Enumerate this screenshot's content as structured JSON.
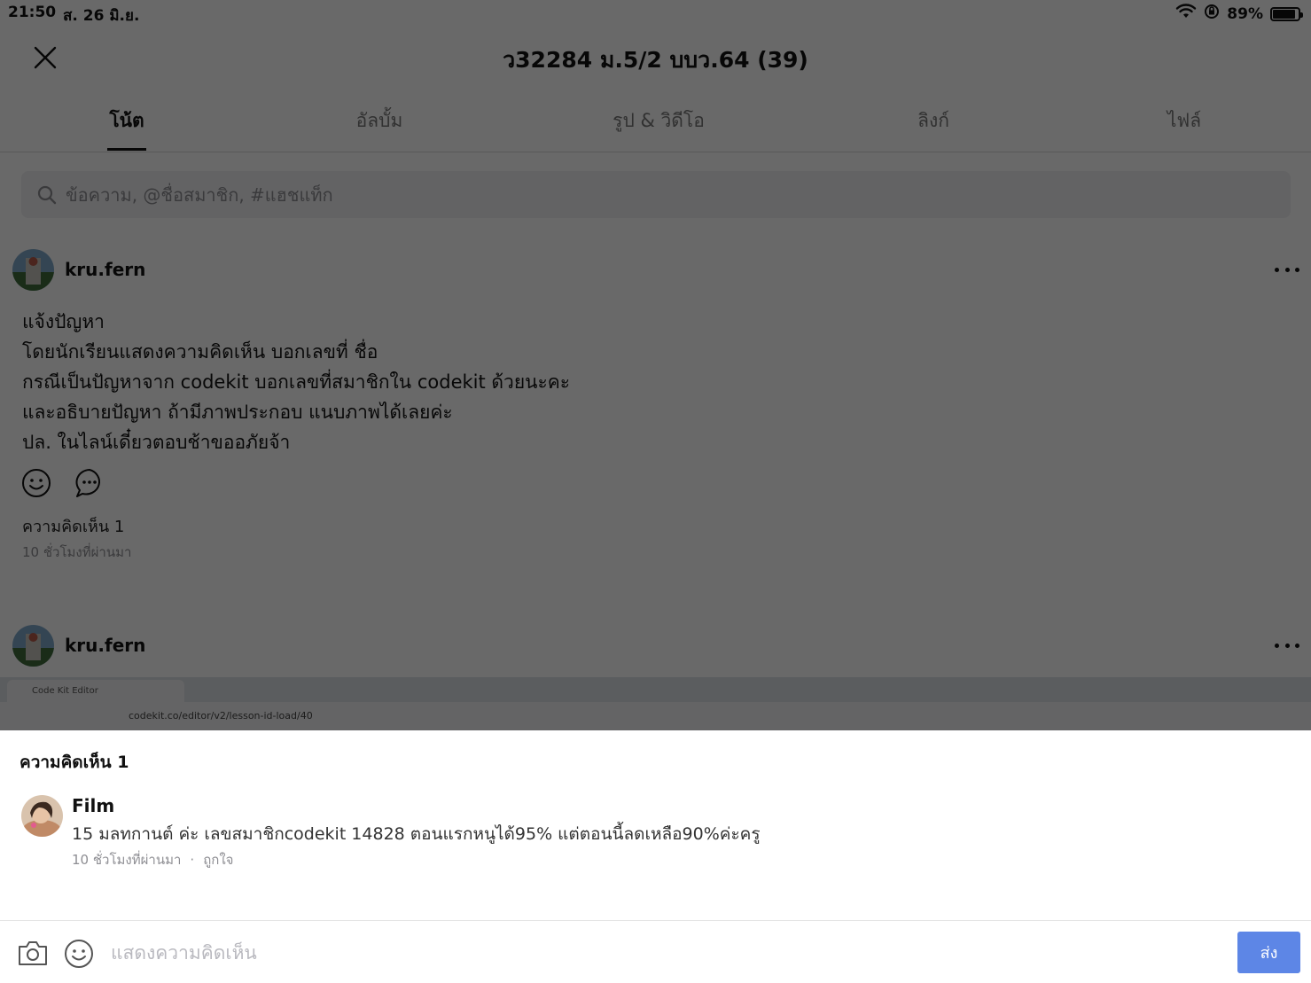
{
  "status_bar": {
    "time": "21:50",
    "date": "ส. 26 มิ.ย.",
    "battery": "89%",
    "battery_level": 0.89
  },
  "header": {
    "title": "ว32284 ม.5/2 บบว.64 (39)"
  },
  "tabs": [
    {
      "label": "โน้ต",
      "active": true
    },
    {
      "label": "อัลบั้ม",
      "active": false
    },
    {
      "label": "รูป & วิดีโอ",
      "active": false
    },
    {
      "label": "ลิงก์",
      "active": false
    },
    {
      "label": "ไฟล์",
      "active": false
    }
  ],
  "search": {
    "placeholder": "ข้อความ, @ชื่อสมาชิก, #แฮชแท็ก"
  },
  "post1": {
    "author": "kru.fern",
    "lines": [
      "แจ้งปัญหา",
      "โดยนักเรียนแสดงความคิดเห็น บอกเลขที่ ชื่อ",
      "กรณีเป็นปัญหาจาก codekit บอกเลขที่สมาชิกใน codekit ด้วยนะคะ",
      "และอธิบายปัญหา ถ้ามีภาพประกอบ แนบภาพได้เลยค่ะ",
      "ปล. ในไลน์เดี๋ยวตอบช้าขออภัยจ้า"
    ],
    "comment_count": "ความคิดเห็น 1",
    "time": "10 ชั่วโมงที่ผ่านมา"
  },
  "post2": {
    "author": "kru.fern",
    "screenshot_tab": "Code Kit Editor",
    "screenshot_url": "codekit.co/editor/v2/lesson-id-load/40"
  },
  "sheet": {
    "title": "ความคิดเห็น 1",
    "comment": {
      "name": "Film",
      "text": "15 มลทกานต์ ค่ะ  เลขสมาชิกcodekit 14828   ตอนแรกหนูได้95% แต่ตอนนี้ลดเหลือ90%ค่ะครู",
      "time": "10 ชั่วโมงที่ผ่านมา",
      "separator": "·",
      "like": "ถูกใจ"
    },
    "composer": {
      "placeholder": "แสดงความคิดเห็น",
      "send": "ส่ง"
    }
  }
}
